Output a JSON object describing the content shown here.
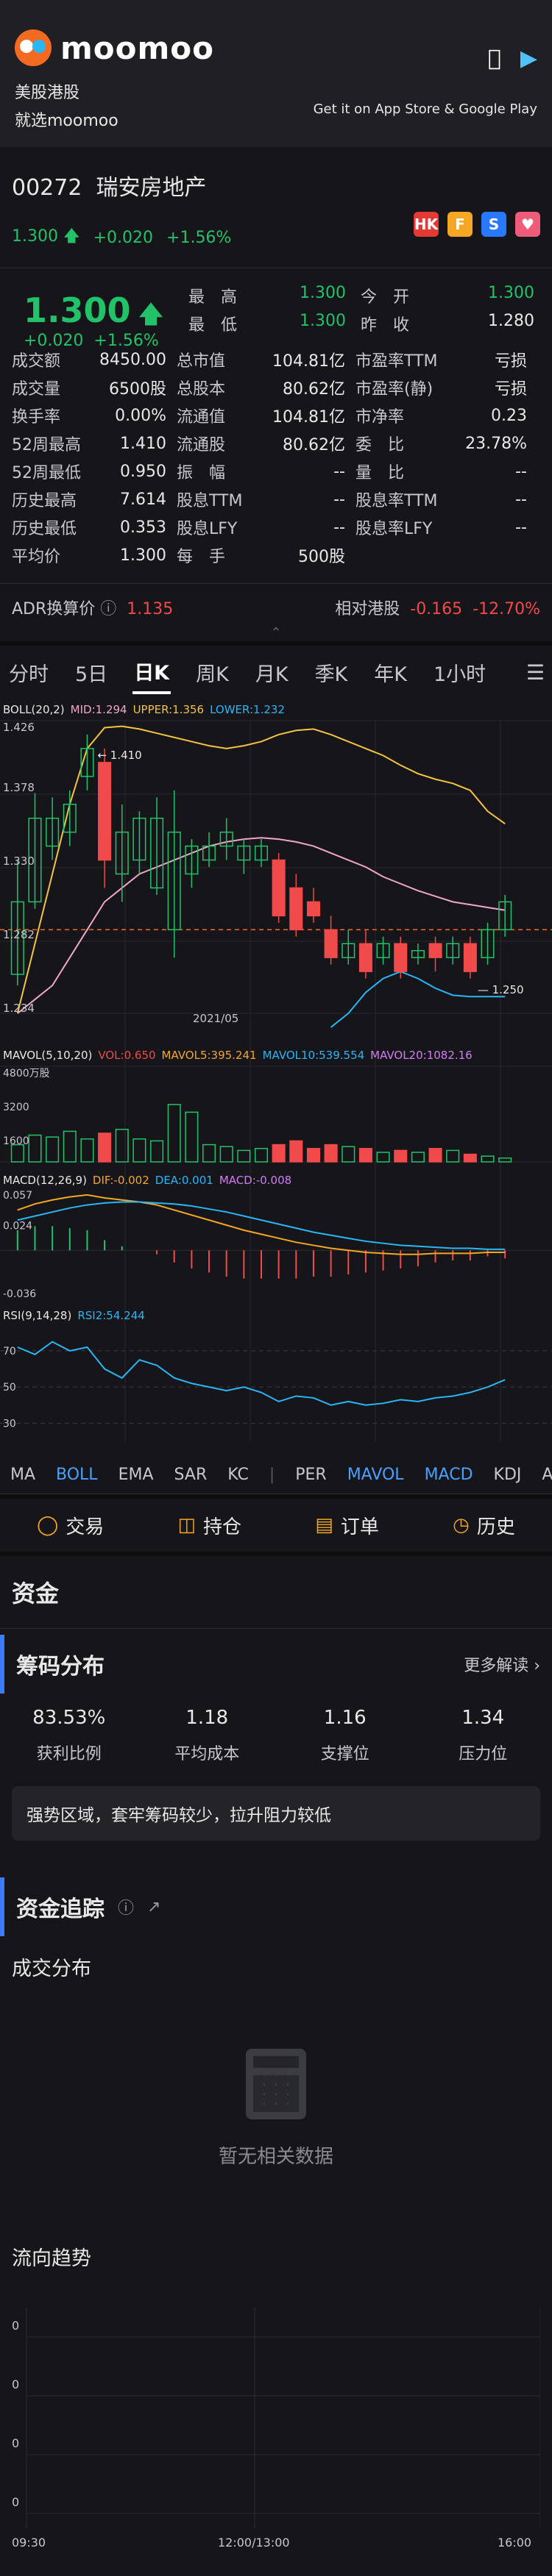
{
  "header": {
    "brand": "moomoo",
    "tagline_1": "美股港股",
    "tagline_2": "就选moomoo",
    "store_text": "Get it on App Store & Google Play",
    "icons": [
      "apple-icon",
      "google-play-icon"
    ]
  },
  "stock": {
    "code": "00272",
    "name": "瑞安房地产",
    "price": "1.300",
    "change": "+0.020",
    "change_pct": "+1.56%",
    "badges": [
      "HK",
      "F",
      "S",
      "♥"
    ]
  },
  "quote": {
    "rows": [
      [
        {
          "l": "成交额",
          "v": "8450.00"
        },
        {
          "l": "总市值",
          "v": "104.81亿"
        },
        {
          "l": "市盈率TTM",
          "v": "亏损"
        }
      ],
      [
        {
          "l": "成交量",
          "v": "6500股"
        },
        {
          "l": "总股本",
          "v": "80.62亿"
        },
        {
          "l": "市盈率(静)",
          "v": "亏损"
        }
      ],
      [
        {
          "l": "换手率",
          "v": "0.00%"
        },
        {
          "l": "流通值",
          "v": "104.81亿"
        },
        {
          "l": "市净率",
          "v": "0.23"
        }
      ],
      [
        {
          "l": "52周最高",
          "v": "1.410"
        },
        {
          "l": "流通股",
          "v": "80.62亿"
        },
        {
          "l": "委　比",
          "v": "23.78%"
        }
      ],
      [
        {
          "l": "52周最低",
          "v": "0.950"
        },
        {
          "l": "振　幅",
          "v": "--"
        },
        {
          "l": "量　比",
          "v": "--"
        }
      ],
      [
        {
          "l": "历史最高",
          "v": "7.614"
        },
        {
          "l": "股息TTM",
          "v": "--"
        },
        {
          "l": "股息率TTM",
          "v": "--"
        }
      ],
      [
        {
          "l": "历史最低",
          "v": "0.353"
        },
        {
          "l": "股息LFY",
          "v": "--"
        },
        {
          "l": "股息率LFY",
          "v": "--"
        }
      ],
      [
        {
          "l": "平均价",
          "v": "1.300"
        },
        {
          "l": "每　手",
          "v": "500股"
        },
        {
          "l": "",
          "v": ""
        }
      ]
    ],
    "top": {
      "high_l": "最　高",
      "high_v": "1.300",
      "open_l": "今　开",
      "open_v": "1.300",
      "low_l": "最　低",
      "low_v": "1.300",
      "prev_l": "昨　收",
      "prev_v": "1.280"
    },
    "adr_label": "ADR换算价",
    "adr_value": "1.135",
    "rel_label": "相对港股",
    "rel_value": "-0.165",
    "rel_pct": "-12.70%"
  },
  "tabs": [
    "分时",
    "5日",
    "日K",
    "周K",
    "月K",
    "季K",
    "年K",
    "1小时"
  ],
  "active_tab": "日K",
  "indicators": {
    "boll": {
      "name": "BOLL(20,2)",
      "mid": "MID:1.294",
      "upper": "UPPER:1.356",
      "lower": "LOWER:1.232"
    },
    "mavol": {
      "name": "MAVOL(5,10,20)",
      "vol": "VOL:0.650",
      "ma5": "MAVOL5:395.241",
      "ma10": "MAVOL10:539.554",
      "ma20": "MAVOL20:1082.16"
    },
    "macd": {
      "name": "MACD(12,26,9)",
      "dif": "DIF:-0.002",
      "dea": "DEA:0.001",
      "macd": "MACD:-0.008"
    },
    "rsi": {
      "name": "RSI(9,14,28)",
      "rsi": "RSI2:54.244"
    }
  },
  "chart_data": {
    "type": "candlestick",
    "price_axis": [
      "1.426",
      "1.378",
      "1.330",
      "1.282",
      "1.234"
    ],
    "vol_axis": [
      "4800万股",
      "3200",
      "1600"
    ],
    "macd_axis": [
      "0.057",
      "0.024",
      "-0.036"
    ],
    "rsi_axis": [
      "70",
      "50",
      "30"
    ],
    "date_label": "2021/05",
    "high_annot": "1.410",
    "low_annot": "1.250",
    "prev_close": 1.28,
    "candles": [
      {
        "o": 1.248,
        "c": 1.3,
        "h": 1.33,
        "l": 1.24
      },
      {
        "o": 1.3,
        "c": 1.36,
        "h": 1.378,
        "l": 1.295
      },
      {
        "o": 1.34,
        "c": 1.36,
        "h": 1.375,
        "l": 1.33
      },
      {
        "o": 1.35,
        "c": 1.37,
        "h": 1.38,
        "l": 1.34
      },
      {
        "o": 1.39,
        "c": 1.41,
        "h": 1.42,
        "l": 1.38
      },
      {
        "o": 1.4,
        "c": 1.33,
        "h": 1.41,
        "l": 1.31
      },
      {
        "o": 1.32,
        "c": 1.35,
        "h": 1.37,
        "l": 1.3
      },
      {
        "o": 1.33,
        "c": 1.36,
        "h": 1.365,
        "l": 1.32
      },
      {
        "o": 1.31,
        "c": 1.36,
        "h": 1.375,
        "l": 1.305
      },
      {
        "o": 1.28,
        "c": 1.35,
        "h": 1.38,
        "l": 1.26
      },
      {
        "o": 1.32,
        "c": 1.34,
        "h": 1.345,
        "l": 1.31
      },
      {
        "o": 1.33,
        "c": 1.34,
        "h": 1.35,
        "l": 1.325
      },
      {
        "o": 1.34,
        "c": 1.35,
        "h": 1.36,
        "l": 1.33
      },
      {
        "o": 1.33,
        "c": 1.34,
        "h": 1.345,
        "l": 1.32
      },
      {
        "o": 1.33,
        "c": 1.34,
        "h": 1.345,
        "l": 1.325
      },
      {
        "o": 1.33,
        "c": 1.29,
        "h": 1.335,
        "l": 1.285
      },
      {
        "o": 1.31,
        "c": 1.28,
        "h": 1.32,
        "l": 1.275
      },
      {
        "o": 1.3,
        "c": 1.29,
        "h": 1.31,
        "l": 1.285
      },
      {
        "o": 1.28,
        "c": 1.26,
        "h": 1.29,
        "l": 1.255
      },
      {
        "o": 1.26,
        "c": 1.27,
        "h": 1.28,
        "l": 1.255
      },
      {
        "o": 1.27,
        "c": 1.25,
        "h": 1.28,
        "l": 1.245
      },
      {
        "o": 1.26,
        "c": 1.27,
        "h": 1.275,
        "l": 1.255
      },
      {
        "o": 1.27,
        "c": 1.25,
        "h": 1.275,
        "l": 1.245
      },
      {
        "o": 1.26,
        "c": 1.265,
        "h": 1.27,
        "l": 1.255
      },
      {
        "o": 1.27,
        "c": 1.26,
        "h": 1.275,
        "l": 1.25
      },
      {
        "o": 1.26,
        "c": 1.27,
        "h": 1.275,
        "l": 1.255
      },
      {
        "o": 1.27,
        "c": 1.25,
        "h": 1.275,
        "l": 1.245
      },
      {
        "o": 1.26,
        "c": 1.28,
        "h": 1.285,
        "l": 1.255
      },
      {
        "o": 1.28,
        "c": 1.3,
        "h": 1.305,
        "l": 1.275
      }
    ],
    "volumes": [
      900,
      1400,
      1300,
      1600,
      1200,
      1500,
      1700,
      1200,
      1100,
      3000,
      2600,
      900,
      800,
      600,
      700,
      900,
      1100,
      700,
      900,
      800,
      700,
      500,
      600,
      500,
      700,
      600,
      400,
      300,
      200
    ],
    "upper": [
      1.22,
      1.27,
      1.32,
      1.37,
      1.41,
      1.425,
      1.426,
      1.424,
      1.421,
      1.418,
      1.415,
      1.412,
      1.41,
      1.412,
      1.415,
      1.42,
      1.423,
      1.424,
      1.42,
      1.415,
      1.41,
      1.405,
      1.398,
      1.392,
      1.388,
      1.385,
      1.38,
      1.365,
      1.356
    ],
    "mid": [
      1.22,
      1.23,
      1.24,
      1.26,
      1.28,
      1.3,
      1.31,
      1.32,
      1.325,
      1.33,
      1.335,
      1.34,
      1.343,
      1.345,
      1.346,
      1.345,
      1.343,
      1.34,
      1.335,
      1.33,
      1.325,
      1.318,
      1.313,
      1.308,
      1.304,
      1.3,
      1.298,
      1.296,
      1.294
    ],
    "lower": [
      null,
      null,
      null,
      null,
      null,
      null,
      null,
      null,
      null,
      null,
      null,
      null,
      null,
      null,
      null,
      null,
      null,
      null,
      1.21,
      1.22,
      1.235,
      1.245,
      1.25,
      1.245,
      1.238,
      1.233,
      1.232,
      1.232,
      1.232
    ],
    "rsi": [
      72,
      68,
      75,
      70,
      72,
      60,
      55,
      65,
      62,
      55,
      52,
      50,
      48,
      50,
      47,
      42,
      45,
      44,
      40,
      42,
      40,
      41,
      43,
      42,
      44,
      45,
      47,
      50,
      54
    ],
    "macd_dif": [
      0.04,
      0.046,
      0.05,
      0.053,
      0.055,
      0.052,
      0.05,
      0.048,
      0.045,
      0.04,
      0.035,
      0.03,
      0.025,
      0.02,
      0.016,
      0.012,
      0.008,
      0.005,
      0.002,
      0.0,
      -0.002,
      -0.003,
      -0.004,
      -0.004,
      -0.003,
      -0.003,
      -0.003,
      -0.002,
      -0.002
    ],
    "macd_dea": [
      0.03,
      0.034,
      0.038,
      0.042,
      0.045,
      0.047,
      0.048,
      0.048,
      0.047,
      0.046,
      0.044,
      0.041,
      0.038,
      0.034,
      0.03,
      0.026,
      0.022,
      0.018,
      0.015,
      0.012,
      0.009,
      0.007,
      0.005,
      0.004,
      0.003,
      0.002,
      0.002,
      0.001,
      0.001
    ],
    "macd_hist": [
      0.02,
      0.024,
      0.024,
      0.022,
      0.02,
      0.01,
      0.004,
      0.0,
      -0.004,
      -0.012,
      -0.018,
      -0.022,
      -0.026,
      -0.028,
      -0.028,
      -0.028,
      -0.028,
      -0.026,
      -0.026,
      -0.024,
      -0.022,
      -0.02,
      -0.018,
      -0.016,
      -0.012,
      -0.01,
      -0.01,
      -0.006,
      -0.008
    ]
  },
  "indicator_bar": [
    "MA",
    "BOLL",
    "EMA",
    "SAR",
    "KC",
    "PER",
    "MAVOL",
    "MACD",
    "KDJ",
    "A"
  ],
  "indicator_active": [
    "BOLL",
    "MAVOL",
    "MACD"
  ],
  "actions": [
    {
      "label": "交易",
      "icon": "trade-icon"
    },
    {
      "label": "持仓",
      "icon": "position-icon"
    },
    {
      "label": "订单",
      "icon": "order-icon"
    },
    {
      "label": "历史",
      "icon": "history-icon"
    }
  ],
  "funds": {
    "title": "资金",
    "chip_title": "筹码分布",
    "more": "更多解读",
    "stats": [
      {
        "v": "83.53%",
        "l": "获利比例"
      },
      {
        "v": "1.18",
        "l": "平均成本"
      },
      {
        "v": "1.16",
        "l": "支撑位"
      },
      {
        "v": "1.34",
        "l": "压力位"
      }
    ],
    "note": "强势区域，套牢筹码较少，拉升阻力较低",
    "tracking_title": "资金追踪",
    "deal_dist": "成交分布",
    "empty_text": "暂无相关数据",
    "flow_title": "流向趋势",
    "flow_y": [
      "0",
      "0",
      "0",
      "0"
    ],
    "flow_x": [
      "09:30",
      "12:00/13:00",
      "16:00"
    ]
  }
}
